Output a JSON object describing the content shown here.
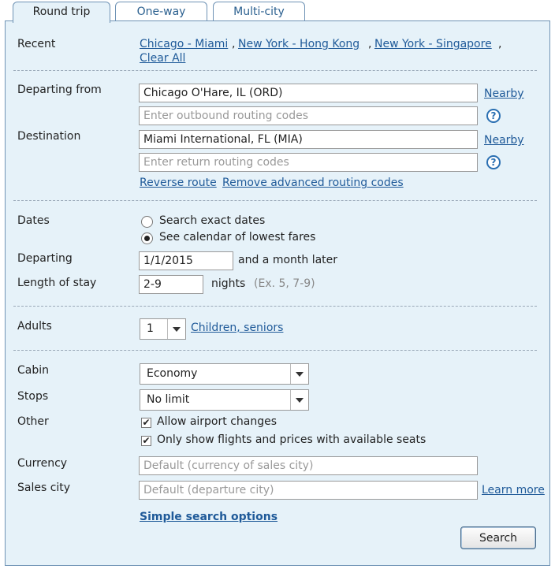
{
  "tabs": [
    {
      "label": "Round trip",
      "active": true
    },
    {
      "label": "One-way",
      "active": false
    },
    {
      "label": "Multi-city",
      "active": false
    }
  ],
  "recent": {
    "label": "Recent",
    "links": [
      "Chicago - Miami",
      "New York - Hong Kong",
      "New York - Singapore"
    ],
    "separator": ",",
    "clear_all": "Clear All"
  },
  "routing": {
    "departing_label": "Departing from",
    "departing_value": "Chicago O'Hare, IL (ORD)",
    "outbound_placeholder": "Enter outbound routing codes",
    "destination_label": "Destination",
    "destination_value": "Miami International, FL (MIA)",
    "return_placeholder": "Enter return routing codes",
    "nearby": "Nearby",
    "help_glyph": "?",
    "reverse_route": "Reverse route",
    "remove_advanced": "Remove advanced routing codes"
  },
  "dates": {
    "label": "Dates",
    "option_exact": "Search exact dates",
    "option_calendar": "See calendar of lowest fares",
    "selected": "calendar",
    "departing_label": "Departing",
    "departing_value": "1/1/2015",
    "departing_suffix": "and a month later",
    "stay_label": "Length of stay",
    "stay_value": "2-9",
    "stay_unit": "nights",
    "stay_hint": "(Ex. 5, 7-9)"
  },
  "passengers": {
    "adults_label": "Adults",
    "adults_value": "1",
    "children_link": "Children, seniors"
  },
  "options": {
    "cabin_label": "Cabin",
    "cabin_value": "Economy",
    "stops_label": "Stops",
    "stops_value": "No limit",
    "other_label": "Other",
    "allow_airport_changes": "Allow airport changes",
    "available_seats_only": "Only show flights and prices with available seats",
    "check_glyph": "✔",
    "currency_label": "Currency",
    "currency_placeholder": "Default (currency of sales city)",
    "sales_city_label": "Sales city",
    "sales_city_placeholder": "Default (departure city)",
    "learn_more": "Learn more"
  },
  "footer": {
    "simple_search": "Simple search options",
    "search_button": "Search"
  }
}
